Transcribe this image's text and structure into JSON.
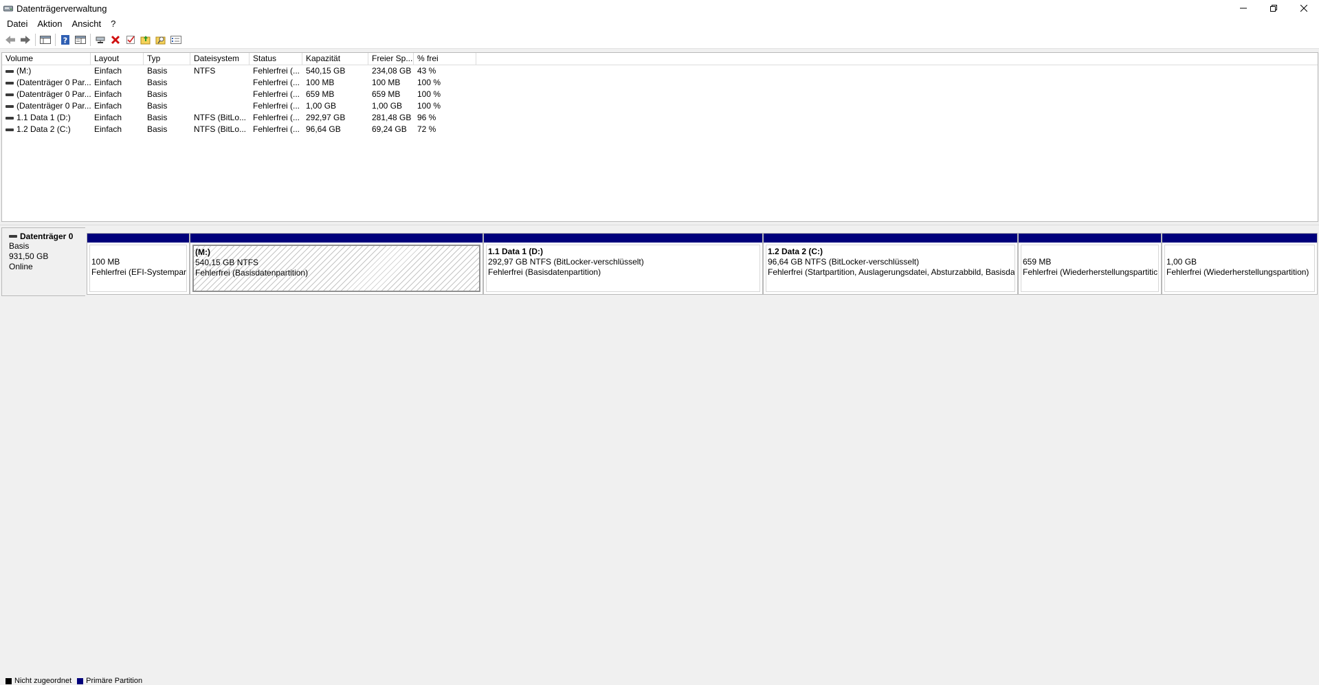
{
  "window": {
    "title": "Datenträgerverwaltung"
  },
  "menu": {
    "items": [
      "Datei",
      "Aktion",
      "Ansicht",
      "?"
    ]
  },
  "toolbar": {
    "buttons": [
      "back-icon",
      "forward-icon",
      "console-tree-icon",
      "help-icon",
      "properties-icon",
      "connect-icon",
      "delete-icon",
      "check-icon",
      "folder-up-icon",
      "search-folder-icon",
      "list-view-icon"
    ]
  },
  "volume_table": {
    "columns": [
      "Volume",
      "Layout",
      "Typ",
      "Dateisystem",
      "Status",
      "Kapazität",
      "Freier Sp...",
      "% frei"
    ],
    "rows": [
      [
        "(M:)",
        "Einfach",
        "Basis",
        "NTFS",
        "Fehlerfrei (...",
        "540,15 GB",
        "234,08 GB",
        "43 %"
      ],
      [
        "(Datenträger 0 Par...",
        "Einfach",
        "Basis",
        "",
        "Fehlerfrei (...",
        "100 MB",
        "100 MB",
        "100 %"
      ],
      [
        "(Datenträger 0 Par...",
        "Einfach",
        "Basis",
        "",
        "Fehlerfrei (...",
        "659 MB",
        "659 MB",
        "100 %"
      ],
      [
        "(Datenträger 0 Par...",
        "Einfach",
        "Basis",
        "",
        "Fehlerfrei (...",
        "1,00 GB",
        "1,00 GB",
        "100 %"
      ],
      [
        "1.1 Data 1 (D:)",
        "Einfach",
        "Basis",
        "NTFS (BitLo...",
        "Fehlerfrei (...",
        "292,97 GB",
        "281,48 GB",
        "96 %"
      ],
      [
        "1.2 Data 2 (C:)",
        "Einfach",
        "Basis",
        "NTFS (BitLo...",
        "Fehlerfrei (...",
        "96,64 GB",
        "69,24 GB",
        "72 %"
      ]
    ]
  },
  "disk": {
    "name": "Datenträger 0",
    "type": "Basis",
    "size": "931,50 GB",
    "state": "Online",
    "partitions": [
      {
        "title": "",
        "size": "100 MB",
        "status": "Fehlerfrei (EFI-Systempart"
      },
      {
        "title": "(M:)",
        "size": "540,15 GB NTFS",
        "status": "Fehlerfrei (Basisdatenpartition)"
      },
      {
        "title": "1.1 Data 1  (D:)",
        "size": "292,97 GB NTFS (BitLocker-verschlüsselt)",
        "status": "Fehlerfrei (Basisdatenpartition)"
      },
      {
        "title": "1.2 Data 2  (C:)",
        "size": "96,64 GB NTFS (BitLocker-verschlüsselt)",
        "status": "Fehlerfrei (Startpartition, Auslagerungsdatei, Absturzabbild, Basisdat"
      },
      {
        "title": "",
        "size": "659 MB",
        "status": "Fehlerfrei (Wiederherstellungspartitic"
      },
      {
        "title": "",
        "size": "1,00 GB",
        "status": "Fehlerfrei (Wiederherstellungspartition)"
      }
    ]
  },
  "legend": {
    "items": [
      {
        "label": "Nicht zugeordnet",
        "color": "#000000"
      },
      {
        "label": "Primäre Partition",
        "color": "#00007b"
      }
    ]
  },
  "colors": {
    "primary_partition": "#00007b",
    "unallocated": "#000000"
  }
}
